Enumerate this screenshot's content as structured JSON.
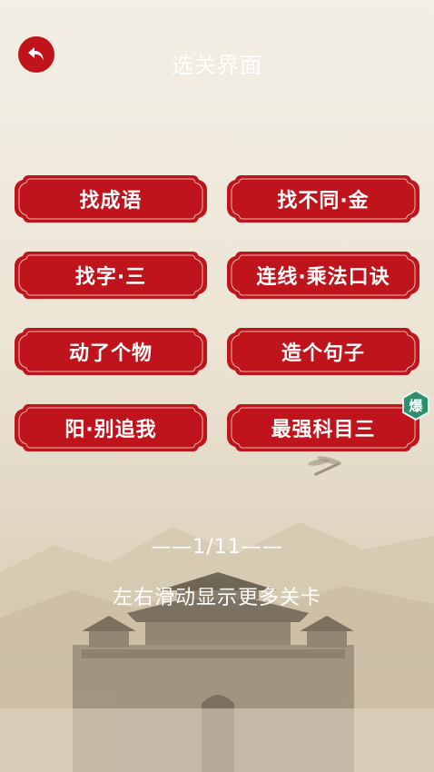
{
  "header": {
    "title": "选关界面"
  },
  "levels": [
    {
      "label": "找成语"
    },
    {
      "label": "找不同·金"
    },
    {
      "label": "找字·三"
    },
    {
      "label": "连线·乘法口诀"
    },
    {
      "label": "动了个物"
    },
    {
      "label": "造个句子"
    },
    {
      "label": "阳·别追我"
    },
    {
      "label": "最强科目三"
    }
  ],
  "badge": {
    "label": "爆"
  },
  "pager": {
    "indicator": "——1/11——",
    "hint": "左右滑动显示更多关卡"
  },
  "colors": {
    "button_red": "#c0141c",
    "badge_green": "#2e8f6f"
  }
}
